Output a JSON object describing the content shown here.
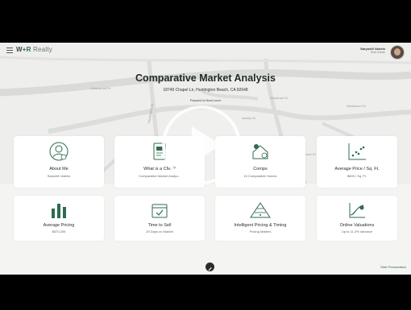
{
  "header": {
    "brand_a": "W",
    "brand_b": "+R",
    "brand_c": "Realty",
    "user_name": "Sarynelli Valerio",
    "user_role": "Real Estate"
  },
  "map_labels": [
    "Colonwood Dr",
    "Huntington Dr",
    "Woodrow Dr",
    "Westwood Dr",
    "Ashley Dr",
    "Elmwood Dr"
  ],
  "main": {
    "title": "Comparative Market Analysis",
    "address": "18749 Chapel Ln, Huntington Beach, CA 92648",
    "prepared_for": "Prepared for Brad Leone"
  },
  "cards": [
    {
      "label": "About Me",
      "sub": "Sarynelli Valerio",
      "icon": "user-circle-icon"
    },
    {
      "label": "What is a CMA?",
      "sub": "Comparative Market Analysis",
      "icon": "document-icon"
    },
    {
      "label": "Comps",
      "sub": "15 Comparable Homes",
      "icon": "house-icon"
    },
    {
      "label": "Average Price / Sq. Ft.",
      "sub": "$605 / Sq. Ft.",
      "icon": "scatter-icon"
    },
    {
      "label": "Average Pricing",
      "sub": "$870,205",
      "icon": "bar-chart-icon"
    },
    {
      "label": "Time to Sell",
      "sub": "29 Days on Market",
      "icon": "calendar-check-icon"
    },
    {
      "label": "Intelligent Pricing & Timing",
      "sub": "Pricing Matters",
      "icon": "pyramid-icon"
    },
    {
      "label": "Online Valuations",
      "sub": "Up to 11.2% Variance",
      "icon": "curve-chart-icon"
    }
  ],
  "footer": {
    "start_label": "Start Presentation"
  },
  "colors": {
    "accent": "#2f6b4f",
    "frame": "#000000",
    "background": "#f4f5f3"
  }
}
